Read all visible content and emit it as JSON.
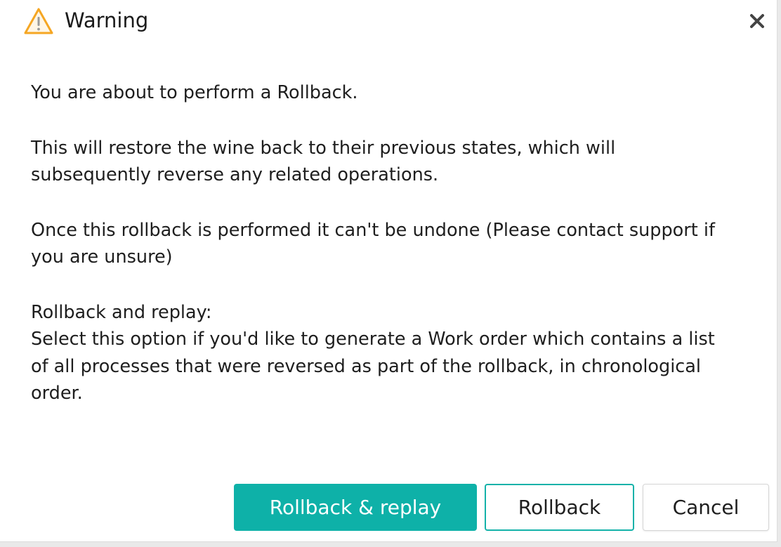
{
  "dialog": {
    "title": "Warning",
    "icon": "warning-icon",
    "close_icon": "close-icon",
    "accent_color": "#0eb1a8",
    "warning_color": "#f5a623"
  },
  "message": {
    "line1": "You are about to perform a Rollback.",
    "line2": "This will restore the wine back to their previous states, which will subsequently reverse any related operations.",
    "line3": "Once this rollback is performed it can't be undone (Please contact support if you are unsure)",
    "line4_heading": "Rollback and replay:",
    "line4_body": "Select this option if you'd like to generate a Work order which contains a list of all processes that were reversed as part of the rollback, in chronological order."
  },
  "buttons": {
    "rollback_replay": "Rollback & replay",
    "rollback": "Rollback",
    "cancel": "Cancel"
  }
}
